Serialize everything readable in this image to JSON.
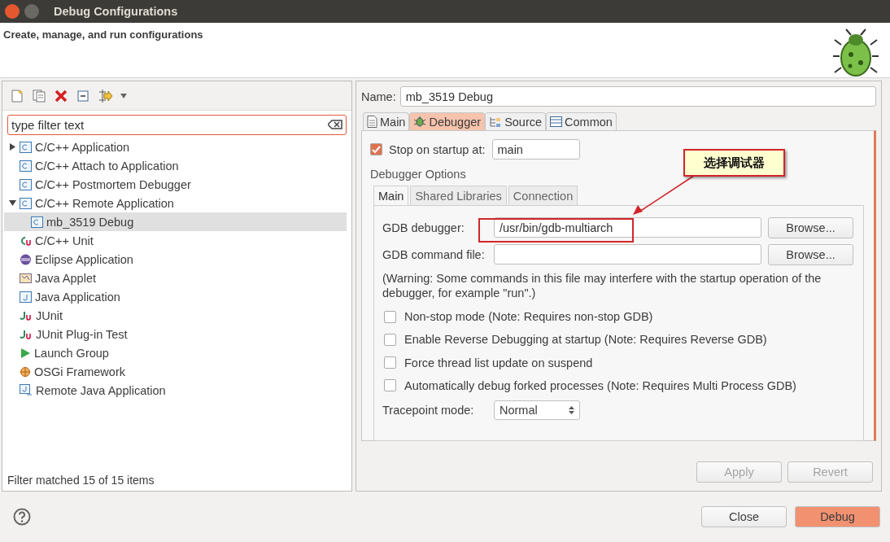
{
  "window": {
    "title": "Debug Configurations"
  },
  "header": {
    "subtitle": "Create, manage, and run configurations"
  },
  "filter": {
    "placeholder": "type filter text"
  },
  "tree": [
    {
      "label": "C/C++ Application",
      "kind": "c-launch",
      "selected": false,
      "expanded": false
    },
    {
      "label": "C/C++ Attach to Application",
      "kind": "c-launch",
      "selected": false
    },
    {
      "label": "C/C++ Postmortem Debugger",
      "kind": "c-launch",
      "selected": false
    },
    {
      "label": "C/C++ Remote Application",
      "kind": "c-launch",
      "selected": false,
      "expanded": true,
      "children": [
        {
          "label": "mb_3519 Debug",
          "kind": "c-launch",
          "selected": true
        }
      ]
    },
    {
      "label": "C/C++ Unit",
      "kind": "unit",
      "selected": false
    },
    {
      "label": "Eclipse Application",
      "kind": "eclipse",
      "selected": false
    },
    {
      "label": "Java Applet",
      "kind": "applet",
      "selected": false
    },
    {
      "label": "Java Application",
      "kind": "java",
      "selected": false
    },
    {
      "label": "JUnit",
      "kind": "junit",
      "selected": false
    },
    {
      "label": "JUnit Plug-in Test",
      "kind": "junit",
      "selected": false
    },
    {
      "label": "Launch Group",
      "kind": "group",
      "selected": false
    },
    {
      "label": "OSGi Framework",
      "kind": "osgi",
      "selected": false
    },
    {
      "label": "Remote Java Application",
      "kind": "remote-java",
      "selected": false
    }
  ],
  "filter_status": "Filter matched 15 of 15 items",
  "name_field": {
    "label": "Name:",
    "value": "mb_3519 Debug"
  },
  "tabs": [
    {
      "label": "Main",
      "kind": "page",
      "selected": false
    },
    {
      "label": "Debugger",
      "kind": "bug",
      "selected": true
    },
    {
      "label": "Source",
      "kind": "source",
      "selected": false
    },
    {
      "label": "Common",
      "kind": "common",
      "selected": false
    }
  ],
  "stop_on_startup": {
    "label": "Stop on startup at:",
    "checked": true,
    "value": "main"
  },
  "debugger_options": {
    "title": "Debugger Options",
    "tabs": [
      {
        "label": "Main",
        "selected": true
      },
      {
        "label": "Shared Libraries",
        "selected": false
      },
      {
        "label": "Connection",
        "selected": false
      }
    ],
    "gdb_debugger": {
      "label": "GDB debugger:",
      "value": "/usr/bin/gdb-multiarch",
      "button": "Browse..."
    },
    "gdb_command_file": {
      "label": "GDB command file:",
      "button": "Browse..."
    },
    "warning": "(Warning: Some commands in this file may interfere with the startup operation of the debugger, for example \"run\".)",
    "options": [
      {
        "label": "Non-stop mode (Note: Requires non-stop GDB)",
        "checked": false
      },
      {
        "label": "Enable Reverse Debugging at startup (Note: Requires Reverse GDB)",
        "checked": false
      },
      {
        "label": "Force thread list update on suspend",
        "checked": false
      },
      {
        "label": "Automatically debug forked processes (Note: Requires Multi Process GDB)",
        "checked": false
      }
    ],
    "tracepoint_mode": {
      "label": "Tracepoint mode:",
      "value": "Normal"
    }
  },
  "annotation": {
    "text": "选择调试器"
  },
  "config_buttons": [
    {
      "label": "Apply",
      "disabled": true
    },
    {
      "label": "Revert",
      "disabled": true
    }
  ],
  "dialog_buttons": [
    {
      "label": "Close",
      "default": false
    },
    {
      "label": "Debug",
      "default": true
    }
  ]
}
